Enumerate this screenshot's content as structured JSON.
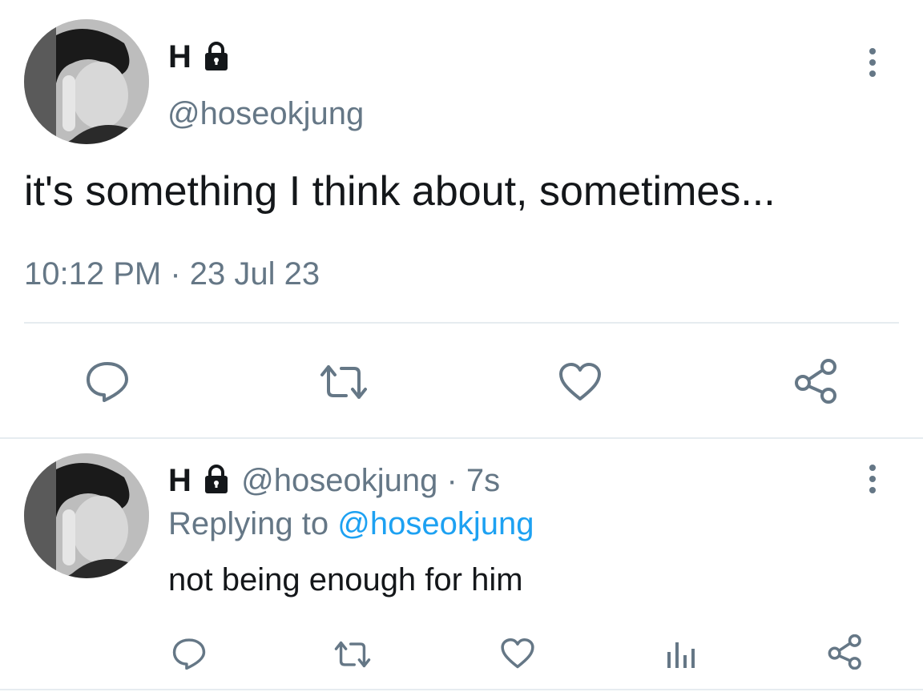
{
  "main_tweet": {
    "display_name": "H",
    "handle": "@hoseokjung",
    "text": "it's something I think about, sometimes...",
    "timestamp": "10:12 PM · 23 Jul 23",
    "actions": [
      "reply-icon",
      "retweet-icon",
      "like-icon",
      "share-icon"
    ]
  },
  "reply_tweet": {
    "display_name": "H",
    "handle": "@hoseokjung",
    "time_ago": "· 7s",
    "replying_prefix": "Replying to",
    "replying_to": "@hoseokjung",
    "text": "not being enough for him",
    "actions": [
      "reply-icon",
      "retweet-icon",
      "like-icon",
      "analytics-icon",
      "share-icon"
    ]
  },
  "colors": {
    "text": "#14171a",
    "muted": "#657786",
    "link": "#1da1f2",
    "divider": "#e6ecf0"
  }
}
